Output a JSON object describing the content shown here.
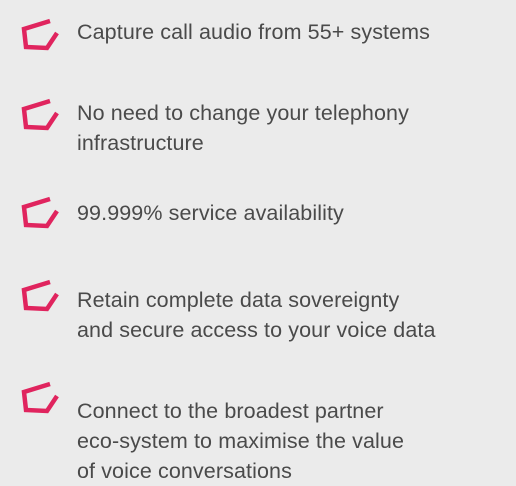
{
  "colors": {
    "background": "#ebebeb",
    "text": "#4a4a4a",
    "icon_accent": "#e0245e"
  },
  "icon_name": "arrow-check-icon",
  "features": [
    {
      "lines": [
        "Capture call audio from 55+ systems"
      ]
    },
    {
      "lines": [
        "No need to change your telephony",
        "infrastructure"
      ]
    },
    {
      "lines": [
        "99.999% service availability"
      ]
    },
    {
      "lines": [
        "Retain complete data sovereignty",
        "and secure access to your voice data"
      ]
    },
    {
      "lines": [
        "Connect to the broadest partner",
        "eco-system to maximise the value",
        "of voice conversations"
      ]
    }
  ]
}
